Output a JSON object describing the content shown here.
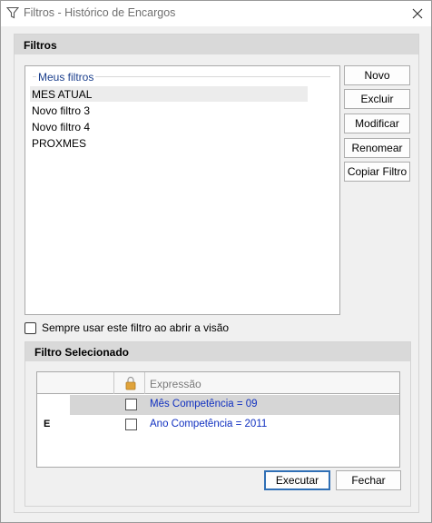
{
  "window": {
    "title": "Filtros - Histórico de Encargos"
  },
  "filters": {
    "header": "Filtros",
    "group_label": "Meus filtros",
    "items": [
      {
        "label": "MES ATUAL",
        "selected": true
      },
      {
        "label": "Novo filtro 3",
        "selected": false
      },
      {
        "label": "Novo filtro 4",
        "selected": false
      },
      {
        "label": "PROXMES",
        "selected": false
      }
    ],
    "buttons": {
      "new": "Novo",
      "delete": "Excluir",
      "modify": "Modificar",
      "rename": "Renomear",
      "copy": "Copiar Filtro"
    },
    "always_use": {
      "label": "Sempre usar este filtro ao abrir a visão",
      "checked": false
    }
  },
  "selected_filter": {
    "header": "Filtro Selecionado",
    "columns": {
      "expression": "Expressão"
    },
    "rows": [
      {
        "operator": "",
        "locked": false,
        "expression": "Mês Competência = 09",
        "selected": true
      },
      {
        "operator": "E",
        "locked": false,
        "expression": "Ano Competência = 2011",
        "selected": false
      }
    ]
  },
  "actions": {
    "execute": "Executar",
    "close": "Fechar"
  },
  "colors": {
    "expression_text": "#1030c0",
    "group_label": "#1a3e8c",
    "default_button_border": "#2f6fb5"
  }
}
